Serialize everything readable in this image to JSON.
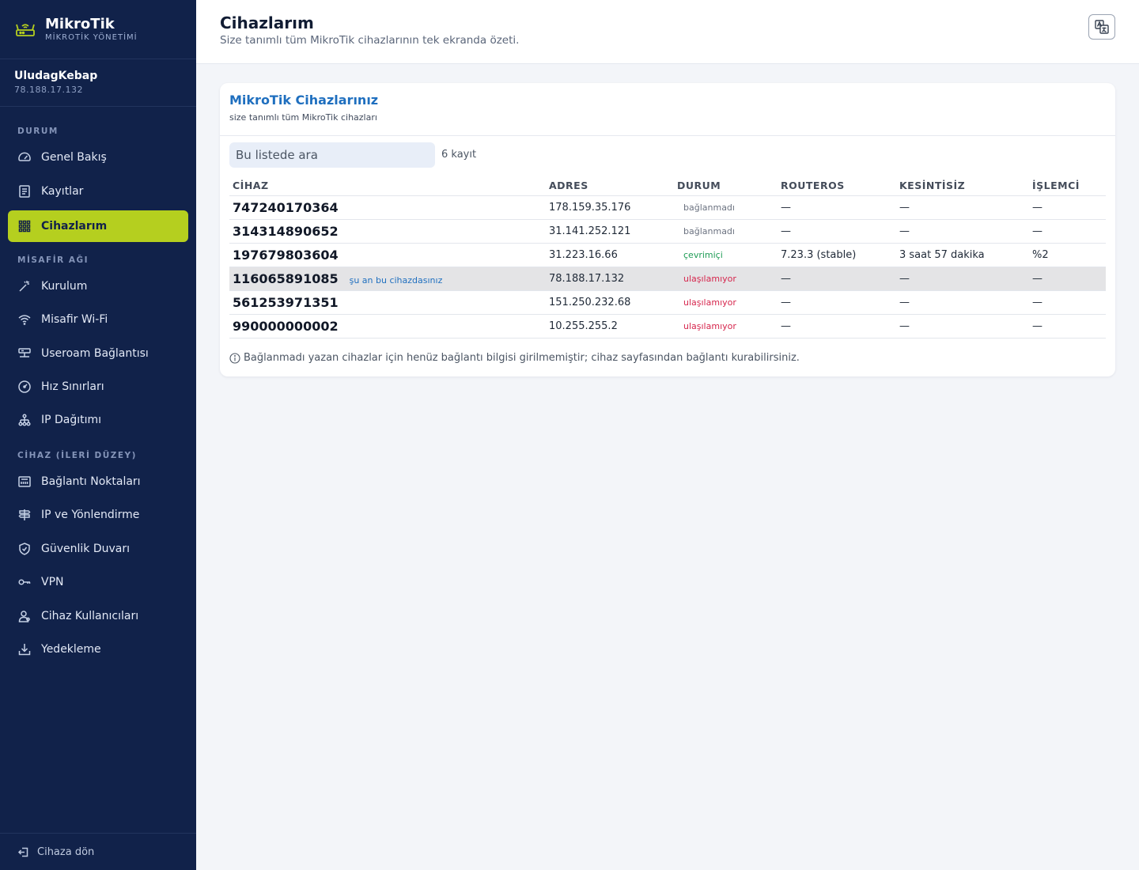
{
  "brand": {
    "title": "MikroTik",
    "subtitle": "MİKROTİK YÖNETİMİ"
  },
  "account": {
    "name": "UludagKebap",
    "ip": "78.188.17.132"
  },
  "sidebar": {
    "sections": [
      {
        "title": "DURUM"
      },
      {
        "title": "MİSAFİR AĞI"
      },
      {
        "title": "CİHAZ (İLERİ DÜZEY)"
      }
    ],
    "items": [
      {
        "label": "Genel Bakış",
        "icon": "gauge-icon"
      },
      {
        "label": "Kayıtlar",
        "icon": "list-icon"
      },
      {
        "label": "Cihazlarım",
        "icon": "grid-icon",
        "active": true
      },
      {
        "label": "Kurulum",
        "icon": "wand-icon"
      },
      {
        "label": "Misafir Wi-Fi",
        "icon": "wifi-icon"
      },
      {
        "label": "Useroam Bağlantısı",
        "icon": "server-icon"
      },
      {
        "label": "Hız Sınırları",
        "icon": "speedometer-icon"
      },
      {
        "label": "IP Dağıtımı",
        "icon": "network-icon"
      },
      {
        "label": "Bağlantı Noktaları",
        "icon": "ethernet-icon"
      },
      {
        "label": "IP ve Yönlendirme",
        "icon": "signpost-icon"
      },
      {
        "label": "Güvenlik Duvarı",
        "icon": "shield-icon"
      },
      {
        "label": "VPN",
        "icon": "key-icon"
      },
      {
        "label": "Cihaz Kullanıcıları",
        "icon": "users-icon"
      },
      {
        "label": "Yedekleme",
        "icon": "download-icon"
      }
    ],
    "footer": "Cihaza dön"
  },
  "header": {
    "title": "Cihazlarım",
    "subtitle": "Size tanımlı tüm MikroTik cihazlarının tek ekranda özeti."
  },
  "card": {
    "title": "MikroTik Cihazlarınız",
    "subtitle": "size tanımlı tüm MikroTik cihazları",
    "search_placeholder": "Bu listede ara",
    "count": "6 kayıt",
    "columns": [
      "CİHAZ",
      "ADRES",
      "DURUM",
      "ROUTEROS",
      "KESİNTİSİZ",
      "İŞLEMCİ"
    ],
    "rows": [
      {
        "device": "747240170364",
        "note": "",
        "address": "178.159.35.176",
        "status": "bağlanmadı",
        "status_kind": "none",
        "routeros": "—",
        "uptime": "—",
        "cpu": "—"
      },
      {
        "device": "314314890652",
        "note": "",
        "address": "31.141.252.121",
        "status": "bağlanmadı",
        "status_kind": "none",
        "routeros": "—",
        "uptime": "—",
        "cpu": "—"
      },
      {
        "device": "197679803604",
        "note": "",
        "address": "31.223.16.66",
        "status": "çevrimiçi",
        "status_kind": "online",
        "routeros": "7.23.3 (stable)",
        "uptime": "3 saat 57 dakika",
        "cpu": "%2"
      },
      {
        "device": "116065891085",
        "note": "şu an bu cihazdasınız",
        "address": "78.188.17.132",
        "status": "ulaşılamıyor",
        "status_kind": "unreach",
        "routeros": "—",
        "uptime": "—",
        "cpu": "—",
        "current": true
      },
      {
        "device": "561253971351",
        "note": "",
        "address": "151.250.232.68",
        "status": "ulaşılamıyor",
        "status_kind": "unreach",
        "routeros": "—",
        "uptime": "—",
        "cpu": "—"
      },
      {
        "device": "990000000002",
        "note": "",
        "address": "10.255.255.2",
        "status": "ulaşılamıyor",
        "status_kind": "unreach",
        "routeros": "—",
        "uptime": "—",
        "cpu": "—"
      }
    ],
    "info": "Bağlanmadı yazan cihazlar için henüz bağlantı bilgisi girilmemiştir; cihaz sayfasından bağlantı kurabilirsiniz."
  },
  "colors": {
    "sidebar": "#11224a",
    "accent": "#b5cf1f",
    "link": "#1f6fbf",
    "online": "#1e9c55",
    "unreachable": "#d6264d"
  }
}
